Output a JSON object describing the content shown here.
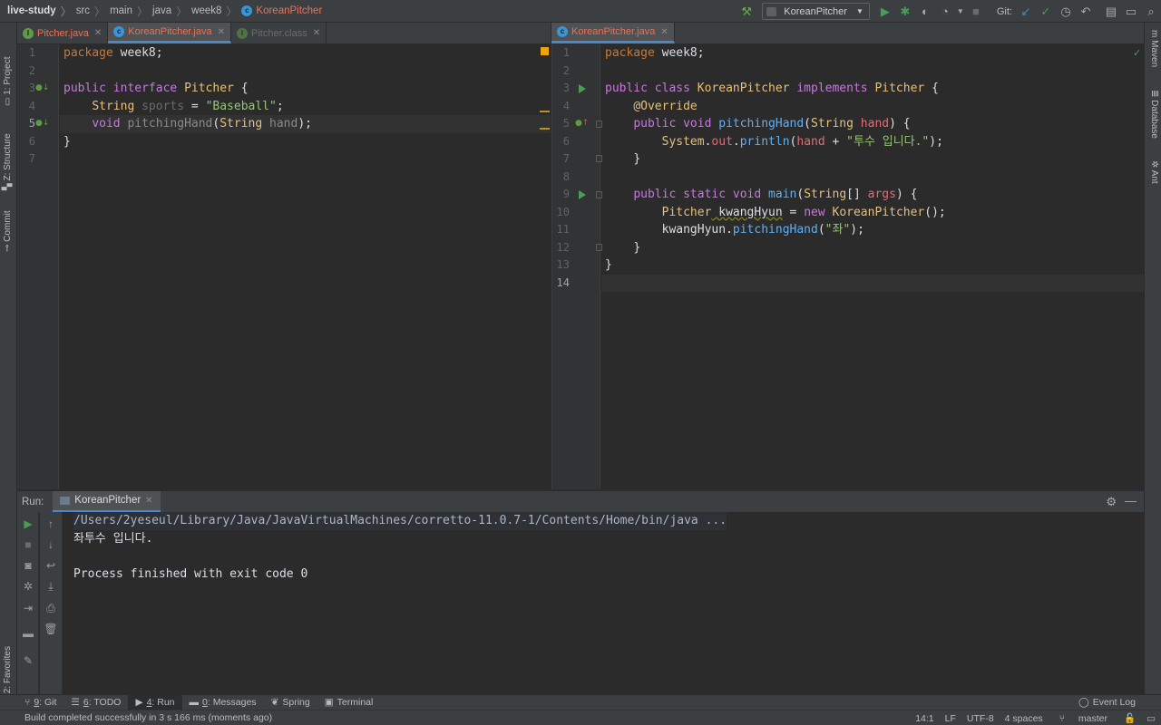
{
  "breadcrumb": {
    "items": [
      "live-study",
      "src",
      "main",
      "java",
      "week8"
    ],
    "current": "KoreanPitcher"
  },
  "toolbar": {
    "run_config": "KoreanPitcher",
    "git_label": "Git:"
  },
  "left_strip": {
    "project": "1: Project",
    "structure": "Z: Structure",
    "commit": "Commit",
    "favorites": "2: Favorites"
  },
  "right_strip": {
    "maven": "Maven",
    "database": "Database",
    "ant": "Ant"
  },
  "left_editor": {
    "tabs": [
      {
        "label": "Pitcher.java",
        "icon": "interface-icon"
      },
      {
        "label": "KoreanPitcher.java",
        "icon": "class-icon"
      },
      {
        "label": "Pitcher.class",
        "icon": "interface-icon"
      }
    ],
    "line_numbers": [
      "1",
      "2",
      "3",
      "4",
      "5",
      "6",
      "7"
    ],
    "lines": {
      "l1_kw": "package",
      "l1_rest": " week8;",
      "l3_a": "public",
      "l3_b": "interface",
      "l3_c": "Pitcher",
      "l3_d": " {",
      "l4_a": "String",
      "l4_b": " sports",
      "l4_c": " = ",
      "l4_d": "\"Baseball\"",
      "l4_e": ";",
      "l5_a": "void",
      "l5_b": " pitchingHand",
      "l5_c": "(",
      "l5_d": "String",
      "l5_e": " hand",
      "l5_f": ");",
      "l6": "}"
    }
  },
  "right_editor": {
    "tabs": [
      {
        "label": "KoreanPitcher.java",
        "icon": "class-icon"
      }
    ],
    "line_numbers": [
      "1",
      "2",
      "3",
      "4",
      "5",
      "6",
      "7",
      "8",
      "9",
      "10",
      "11",
      "12",
      "13",
      "14"
    ],
    "lines": {
      "l1_kw": "package",
      "l1_rest": " week8;",
      "l3_a": "public",
      "l3_b": "class",
      "l3_c": "KoreanPitcher",
      "l3_d": "implements",
      "l3_e": "Pitcher",
      "l3_f": " {",
      "l4": "@Override",
      "l5_a": "public",
      "l5_b": "void",
      "l5_c": "pitchingHand",
      "l5_d": "(",
      "l5_e": "String",
      "l5_f": " hand",
      "l5_g": ") {",
      "l6_a": "System",
      "l6_b": ".",
      "l6_c": "out",
      "l6_d": ".",
      "l6_e": "println",
      "l6_f": "(",
      "l6_g": "hand",
      "l6_h": " + ",
      "l6_i": "\"투수 입니다.\"",
      "l6_j": ");",
      "l7": "}",
      "l9_a": "public",
      "l9_b": "static",
      "l9_c": "void",
      "l9_d": "main",
      "l9_e": "(",
      "l9_f": "String",
      "l9_g": "[] ",
      "l9_h": "args",
      "l9_i": ") {",
      "l10_a": "Pitcher",
      "l10_b": " kwangHyun",
      "l10_c": " = ",
      "l10_d": "new",
      "l10_e": " KoreanPitcher",
      "l10_f": "();",
      "l11_a": "kwangHyun",
      "l11_b": ".",
      "l11_c": "pitchingHand",
      "l11_d": "(",
      "l11_e": "\"좌\"",
      "l11_f": ");",
      "l12": "}",
      "l13": "}"
    }
  },
  "run_panel": {
    "title": "Run:",
    "tab_label": "KoreanPitcher",
    "output": [
      "/Users/2yeseul/Library/Java/JavaVirtualMachines/corretto-11.0.7-1/Contents/Home/bin/java ...",
      "좌투수 입니다.",
      "",
      "Process finished with exit code 0"
    ]
  },
  "tool_tabs": [
    {
      "key": "9",
      "label": ": Git"
    },
    {
      "key": "6",
      "label": ": TODO"
    },
    {
      "key": "4",
      "label": ": Run"
    },
    {
      "key": "0",
      "label": ": Messages"
    },
    {
      "key": "",
      "label": "Spring"
    },
    {
      "key": "",
      "label": "Terminal"
    }
  ],
  "event_log": "Event Log",
  "status": {
    "message": "Build completed successfully in 3 s 166 ms (moments ago)",
    "position": "14:1",
    "line_sep": "LF",
    "encoding": "UTF-8",
    "indent": "4 spaces",
    "branch": "master"
  },
  "colors": {
    "accent": "#4a88c7",
    "run_green": "#499c54",
    "error_tab": "#e8735a"
  }
}
